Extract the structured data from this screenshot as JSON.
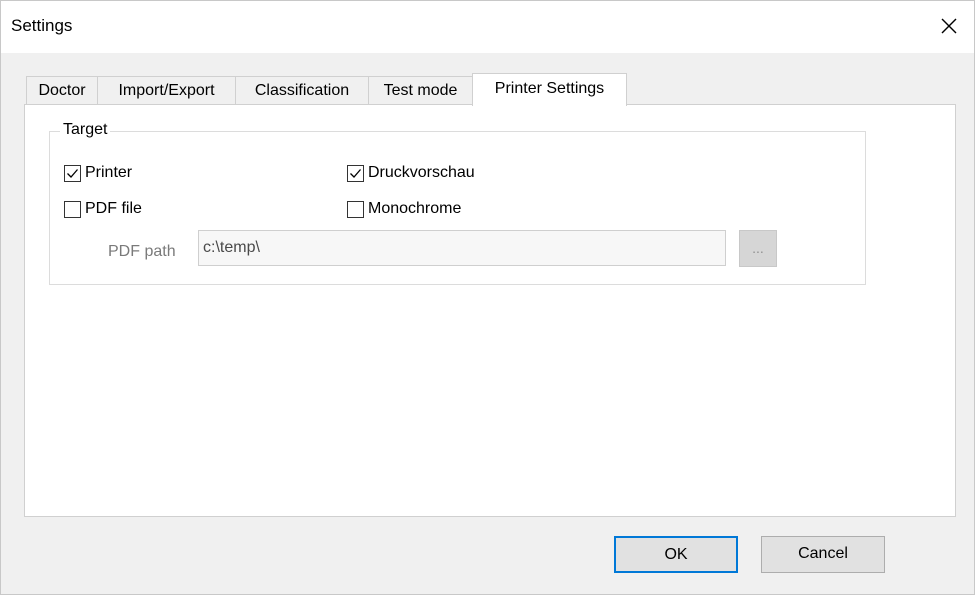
{
  "window": {
    "title": "Settings"
  },
  "tabs": [
    {
      "label": "Doctor"
    },
    {
      "label": "Import/Export"
    },
    {
      "label": "Classification"
    },
    {
      "label": "Test mode"
    },
    {
      "label": "Printer Settings",
      "active": true
    }
  ],
  "target_group": {
    "legend": "Target",
    "printer": {
      "label": "Printer",
      "checked": true
    },
    "pdf_file": {
      "label": "PDF file",
      "checked": false
    },
    "druckvorschau": {
      "label": "Druckvorschau",
      "checked": true
    },
    "monochrome": {
      "label": "Monochrome",
      "checked": false
    },
    "pdf_path": {
      "label": "PDF path",
      "value": "c:\\temp\\"
    },
    "browse_label": "..."
  },
  "buttons": {
    "ok": "OK",
    "cancel": "Cancel"
  },
  "colors": {
    "accent": "#0078d7",
    "dialog_bg": "#f0f0f0"
  }
}
